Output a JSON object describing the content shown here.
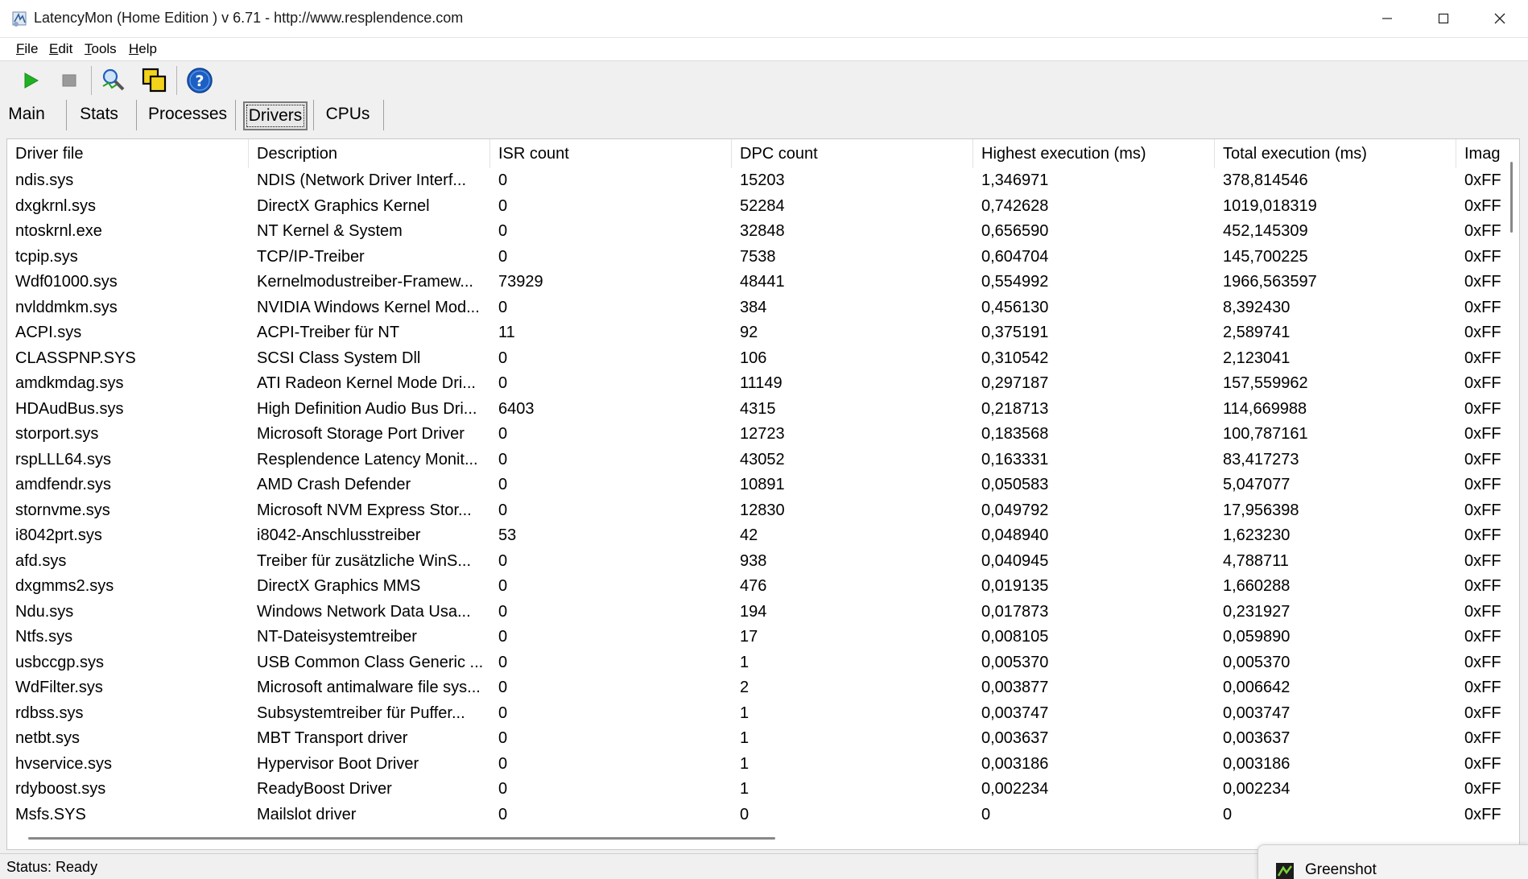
{
  "window": {
    "title": "LatencyMon  (Home Edition )  v 6.71 - http://www.resplendence.com"
  },
  "menu": {
    "items": [
      {
        "label_first": "F",
        "label_rest": "ile"
      },
      {
        "label_first": "E",
        "label_rest": "dit"
      },
      {
        "label_first": "T",
        "label_rest": "ools"
      },
      {
        "label_first": "H",
        "label_rest": "elp"
      }
    ]
  },
  "toolbar": {
    "icons": [
      "play-icon",
      "stop-icon",
      "analyze-icon",
      "copy-windows-icon",
      "help-icon"
    ],
    "colors": {
      "play": "#22b022",
      "stop": "#9a9a9a",
      "help": "#1d5fc2"
    }
  },
  "tabs": {
    "items": [
      {
        "label": "Main"
      },
      {
        "label": "Stats"
      },
      {
        "label": "Processes"
      },
      {
        "label": "Drivers"
      },
      {
        "label": "CPUs"
      }
    ],
    "active": "Drivers"
  },
  "table": {
    "columns": [
      "Driver file",
      "Description",
      "ISR count",
      "DPC count",
      "Highest execution (ms)",
      "Total execution (ms)",
      "Imag"
    ],
    "rows": [
      [
        "ndis.sys",
        "NDIS (Network Driver Interf...",
        "0",
        "15203",
        "1,346971",
        "378,814546",
        "0xFF"
      ],
      [
        "dxgkrnl.sys",
        "DirectX Graphics Kernel",
        "0",
        "52284",
        "0,742628",
        "1019,018319",
        "0xFF"
      ],
      [
        "ntoskrnl.exe",
        "NT Kernel & System",
        "0",
        "32848",
        "0,656590",
        "452,145309",
        "0xFF"
      ],
      [
        "tcpip.sys",
        "TCP/IP-Treiber",
        "0",
        "7538",
        "0,604704",
        "145,700225",
        "0xFF"
      ],
      [
        "Wdf01000.sys",
        "Kernelmodustreiber-Framew...",
        "73929",
        "48441",
        "0,554992",
        "1966,563597",
        "0xFF"
      ],
      [
        "nvlddmkm.sys",
        "NVIDIA Windows Kernel Mod...",
        "0",
        "384",
        "0,456130",
        "8,392430",
        "0xFF"
      ],
      [
        "ACPI.sys",
        "ACPI-Treiber für NT",
        "11",
        "92",
        "0,375191",
        "2,589741",
        "0xFF"
      ],
      [
        "CLASSPNP.SYS",
        "SCSI Class System Dll",
        "0",
        "106",
        "0,310542",
        "2,123041",
        "0xFF"
      ],
      [
        "amdkmdag.sys",
        "ATI Radeon Kernel Mode Dri...",
        "0",
        "11149",
        "0,297187",
        "157,559962",
        "0xFF"
      ],
      [
        "HDAudBus.sys",
        "High Definition Audio Bus Dri...",
        "6403",
        "4315",
        "0,218713",
        "114,669988",
        "0xFF"
      ],
      [
        "storport.sys",
        "Microsoft Storage Port Driver",
        "0",
        "12723",
        "0,183568",
        "100,787161",
        "0xFF"
      ],
      [
        "rspLLL64.sys",
        "Resplendence Latency Monit...",
        "0",
        "43052",
        "0,163331",
        "83,417273",
        "0xFF"
      ],
      [
        "amdfendr.sys",
        "AMD Crash Defender",
        "0",
        "10891",
        "0,050583",
        "5,047077",
        "0xFF"
      ],
      [
        "stornvme.sys",
        "Microsoft NVM Express Stor...",
        "0",
        "12830",
        "0,049792",
        "17,956398",
        "0xFF"
      ],
      [
        "i8042prt.sys",
        "i8042-Anschlusstreiber",
        "53",
        "42",
        "0,048940",
        "1,623230",
        "0xFF"
      ],
      [
        "afd.sys",
        "Treiber für zusätzliche WinS...",
        "0",
        "938",
        "0,040945",
        "4,788711",
        "0xFF"
      ],
      [
        "dxgmms2.sys",
        "DirectX Graphics MMS",
        "0",
        "476",
        "0,019135",
        "1,660288",
        "0xFF"
      ],
      [
        "Ndu.sys",
        "Windows Network Data Usa...",
        "0",
        "194",
        "0,017873",
        "0,231927",
        "0xFF"
      ],
      [
        "Ntfs.sys",
        "NT-Dateisystemtreiber",
        "0",
        "17",
        "0,008105",
        "0,059890",
        "0xFF"
      ],
      [
        "usbccgp.sys",
        "USB Common Class Generic ...",
        "0",
        "1",
        "0,005370",
        "0,005370",
        "0xFF"
      ],
      [
        "WdFilter.sys",
        "Microsoft antimalware file sys...",
        "0",
        "2",
        "0,003877",
        "0,006642",
        "0xFF"
      ],
      [
        "rdbss.sys",
        "Subsystemtreiber für Puffer...",
        "0",
        "1",
        "0,003747",
        "0,003747",
        "0xFF"
      ],
      [
        "netbt.sys",
        "MBT Transport driver",
        "0",
        "1",
        "0,003637",
        "0,003637",
        "0xFF"
      ],
      [
        "hvservice.sys",
        "Hypervisor Boot Driver",
        "0",
        "1",
        "0,003186",
        "0,003186",
        "0xFF"
      ],
      [
        "rdyboost.sys",
        "ReadyBoost Driver",
        "0",
        "1",
        "0,002234",
        "0,002234",
        "0xFF"
      ],
      [
        "Msfs.SYS",
        "Mailslot driver",
        "0",
        "0",
        "0",
        "0",
        "0xFF"
      ]
    ]
  },
  "status": {
    "text": "Status: Ready"
  },
  "taskbar_popup": {
    "label": "Greenshot"
  }
}
